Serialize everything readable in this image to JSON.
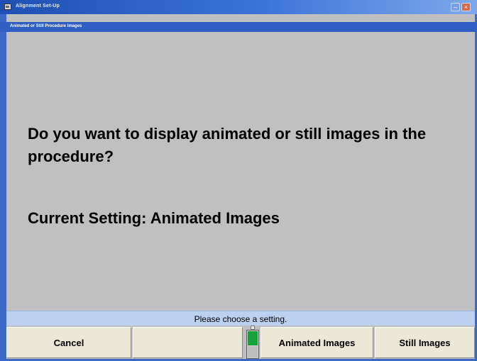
{
  "window": {
    "title": "Alignment Set-Up",
    "minimize_glyph": "–",
    "close_glyph": "×"
  },
  "subtitle": "Animated or Still Procedure Images",
  "main": {
    "question": "Do you want to display animated or still images in the procedure?",
    "current_setting": "Current Setting: Animated Images"
  },
  "status": {
    "message": "Please choose a setting."
  },
  "softkeys": [
    {
      "label": "Cancel"
    },
    {
      "label": ""
    },
    {
      "label": "Animated Images"
    },
    {
      "label": "Still Images"
    }
  ],
  "toggle_indicator": {
    "state": "on",
    "active_color": "#18a33a"
  },
  "colors": {
    "title_bar": "#2f5fc3",
    "background": "#c0c0c0",
    "status_bar": "#bcd0ef",
    "button_face": "#ece8d8"
  }
}
